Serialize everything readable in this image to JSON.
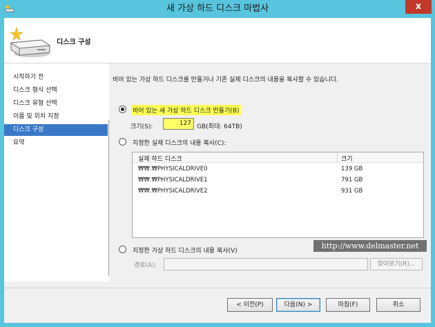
{
  "window": {
    "title": "새 가상 하드 디스크 마법사",
    "close_glyph": "x"
  },
  "header": {
    "title": "디스크 구성",
    "icon": "hard-disk-sparkle-icon"
  },
  "nav": {
    "items": [
      {
        "label": "시작하기 전",
        "active": false
      },
      {
        "label": "디스크 형식 선택",
        "active": false
      },
      {
        "label": "디스크 유형 선택",
        "active": false
      },
      {
        "label": "이름 및 위치 지정",
        "active": false
      },
      {
        "label": "디스크 구성",
        "active": true
      },
      {
        "label": "요약",
        "active": false
      }
    ]
  },
  "main": {
    "description": "비어 있는 가상 하드 디스크를 만들거나 기존 실제 디스크의 내용을 복사할 수 있습니다.",
    "option_new": {
      "label": "비어 있는 새 가상 하드 디스크 만들기(B)",
      "checked": true
    },
    "size": {
      "label": "크기(S):",
      "value": "127",
      "unit": "GB(최대: 64TB)"
    },
    "option_physical": {
      "label": "지정한 실제 디스크의 내용 복사(C):",
      "checked": false
    },
    "disk_table": {
      "columns": [
        "실제 하드 디스크",
        "크기"
      ],
      "rows": [
        [
          "₩₩.₩PHYSICALDRIVE0",
          "139 GB"
        ],
        [
          "₩₩.₩PHYSICALDRIVE1",
          "791 GB"
        ],
        [
          "₩₩.₩PHYSICALDRIVE2",
          "931 GB"
        ]
      ]
    },
    "watermark": "http://www.delmaster.net",
    "option_virtual": {
      "label": "지정한 가상 하드 디스크의 내용 복사(V)",
      "checked": false
    },
    "path": {
      "label": "경로(A):",
      "value": ""
    },
    "browse_label": "찾아보기(R)..."
  },
  "footer": {
    "prev_label": "< 이전(P)",
    "next_label": "다음(N) >",
    "finish_label": "마침(F)",
    "cancel_label": "취소"
  },
  "colors": {
    "titlebar": "#58c4de",
    "nav_active": "#3a78c7",
    "highlight": "#ffff55",
    "close": "#c0392b"
  }
}
